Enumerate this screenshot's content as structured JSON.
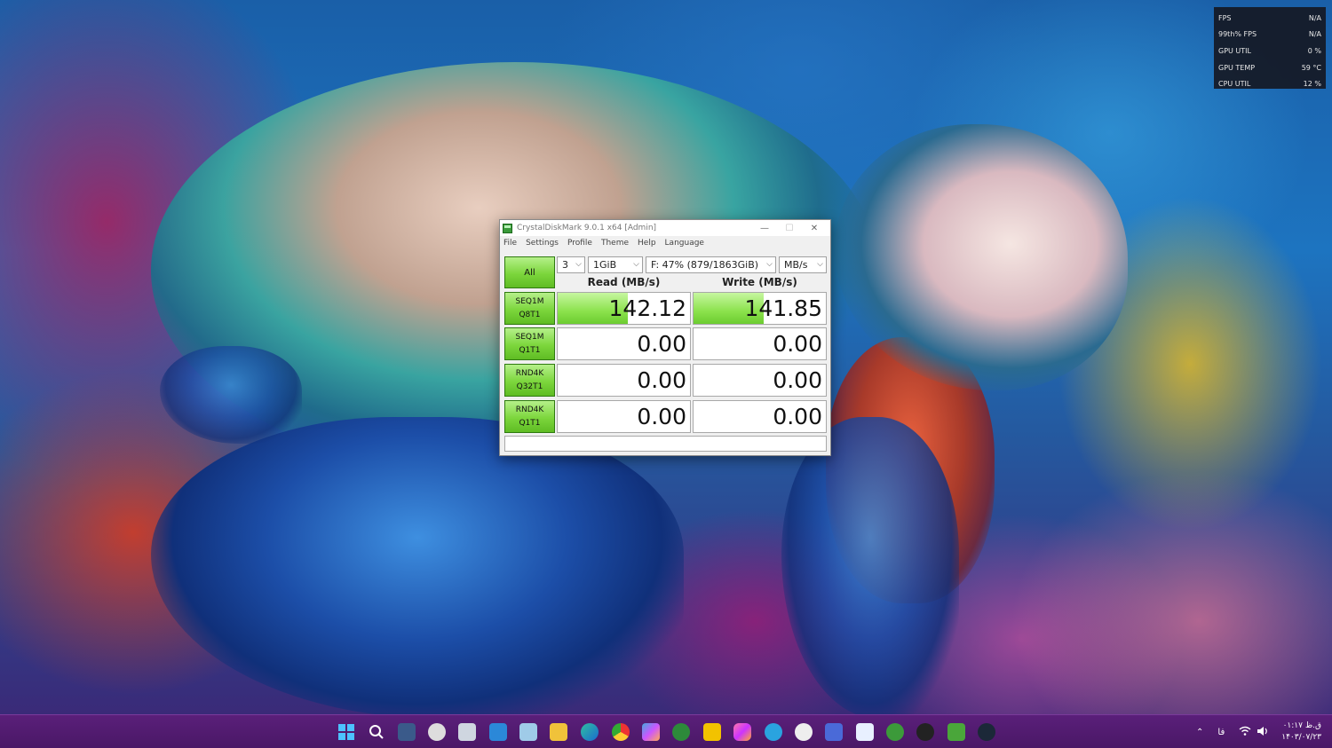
{
  "overlay": {
    "rows": [
      {
        "label": "FPS",
        "value": "N/A"
      },
      {
        "label": "99th% FPS",
        "value": "N/A"
      },
      {
        "label": "GPU UTIL",
        "value": "0 %"
      },
      {
        "label": "GPU TEMP",
        "value": "59 °C"
      },
      {
        "label": "CPU UTIL",
        "value": "12 %"
      }
    ]
  },
  "window": {
    "title": "CrystalDiskMark 9.0.1 x64 [Admin]",
    "menu": [
      "File",
      "Settings",
      "Profile",
      "Theme",
      "Help",
      "Language"
    ],
    "all_button": "All",
    "count_select": "3",
    "size_select": "1GiB",
    "drive_select": "F: 47% (879/1863GiB)",
    "unit_select": "MB/s",
    "read_header": "Read (MB/s)",
    "write_header": "Write (MB/s)",
    "tests": [
      {
        "line1": "SEQ1M",
        "line2": "Q8T1",
        "read": "142.12",
        "write": "141.85",
        "read_fill": 0.53,
        "write_fill": 0.53
      },
      {
        "line1": "SEQ1M",
        "line2": "Q1T1",
        "read": "0.00",
        "write": "0.00",
        "read_fill": 0,
        "write_fill": 0
      },
      {
        "line1": "RND4K",
        "line2": "Q32T1",
        "read": "0.00",
        "write": "0.00",
        "read_fill": 0,
        "write_fill": 0
      },
      {
        "line1": "RND4K",
        "line2": "Q1T1",
        "read": "0.00",
        "write": "0.00",
        "read_fill": 0,
        "write_fill": 0
      }
    ],
    "colors": {
      "accent_green": "#7cd63c",
      "bar_green": "#8be24c"
    }
  },
  "taskbar": {
    "icons": [
      "windows-start-icon",
      "search-icon",
      "file-explorer-icon",
      "clock-app-icon",
      "calculator-icon",
      "photos-icon",
      "screenshot-icon",
      "folder-icon",
      "edge-icon",
      "chrome-icon",
      "copilot-icon",
      "xbox-icon",
      "app-icon",
      "instagram-icon",
      "telegram-icon",
      "wordpress-icon",
      "chart-icon",
      "window-icon",
      "xbox-game-icon",
      "settings-icon",
      "crystaldiskmark-icon",
      "steam-icon"
    ],
    "tray": {
      "lang": "فا",
      "time": "۰۱:۱۷ ق.ظ",
      "date": "۱۴۰۳/۰۷/۲۳"
    },
    "color": "#4a1866"
  }
}
